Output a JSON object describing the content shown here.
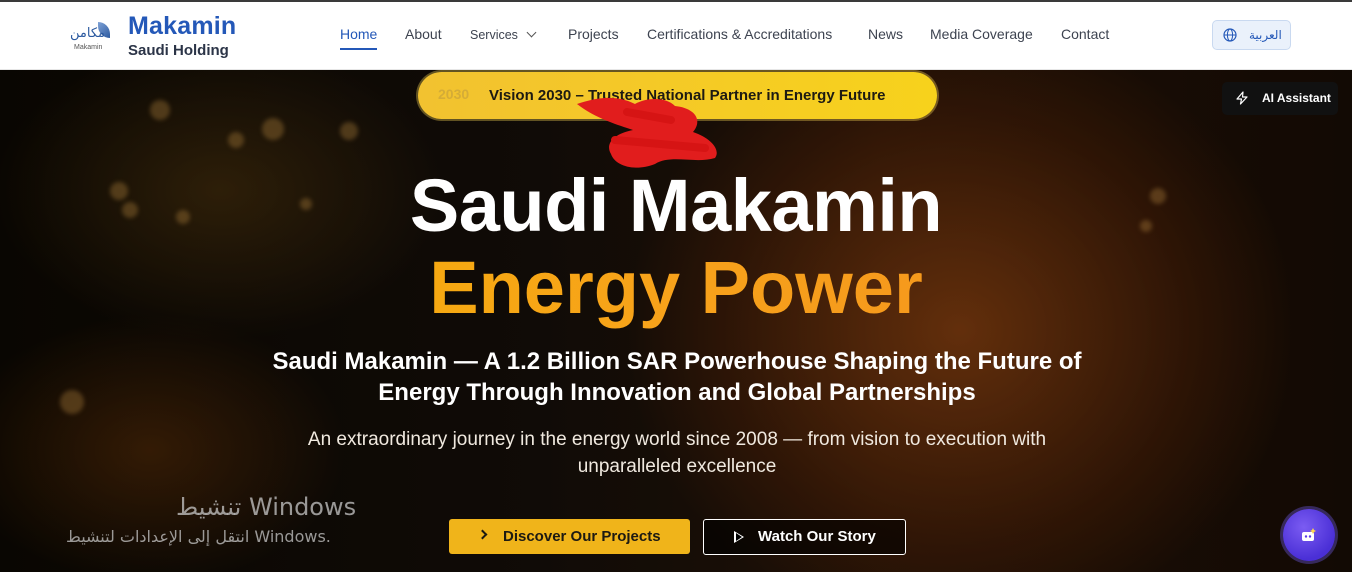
{
  "header": {
    "brand": {
      "name": "Makamin",
      "subtitle": "Saudi Holding",
      "logo_ar": "مكامن",
      "logo_en": "Makamin"
    },
    "nav": [
      {
        "label": "Home",
        "active": true
      },
      {
        "label": "About"
      },
      {
        "label": "Services",
        "has_dropdown": true
      },
      {
        "label": "Projects"
      },
      {
        "label": "Certifications & Accreditations"
      },
      {
        "label": "News"
      },
      {
        "label": "Media Coverage"
      },
      {
        "label": "Contact"
      }
    ],
    "language_button": {
      "label": "العربية",
      "icon": "globe-icon"
    }
  },
  "hero": {
    "vision_badge": {
      "badge_text": "2030",
      "text": "Vision 2030 – Trusted National Partner in Energy Future"
    },
    "ai_assistant": {
      "label": "AI Assistant",
      "icon": "lightning-icon"
    },
    "title_line1": "Saudi Makamin",
    "title_line2": "Energy Power",
    "subtitle": "Saudi Makamin — A 1.2 Billion SAR Powerhouse Shaping the Future of Energy Through Innovation and Global Partnerships",
    "lead": "An extraordinary journey in the energy world since 2008 — from vision to execution with unparalleled excellence",
    "primary_button": "Discover Our Projects",
    "secondary_button": "Watch Our Story",
    "chat_fab_icon": "chat-icon"
  },
  "windows_watermark": {
    "title": "تنشيط Windows",
    "subtitle": "انتقل إلى الإعدادات لتنشيط Windows."
  },
  "colors": {
    "brand_blue": "#2458b8",
    "accent_yellow": "#f0b41a",
    "accent_orange": "#f38a1d",
    "scribble_red": "#e11d1d",
    "fab_purple": "#5b3ce6"
  }
}
